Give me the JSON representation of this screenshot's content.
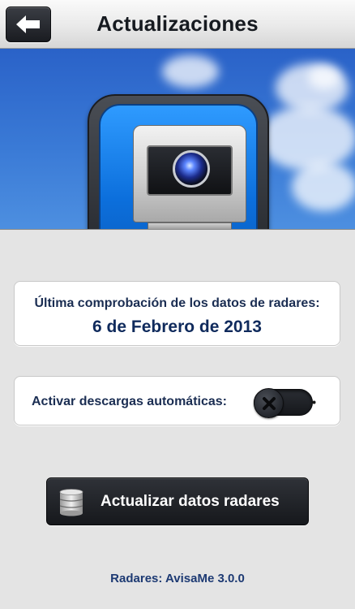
{
  "navbar": {
    "title": "Actualizaciones",
    "back_icon": "arrow-left-icon"
  },
  "hero": {
    "icon": "speed-camera-app-icon"
  },
  "last_check": {
    "label": "Última comprobación de los datos de radares:",
    "date": "6 de Febrero de 2013"
  },
  "auto_download": {
    "label": "Activar descargas automáticas:",
    "enabled": false,
    "toggle_icon": "x-icon"
  },
  "update_button": {
    "label": "Actualizar datos radares",
    "icon": "database-icon"
  },
  "footer": {
    "version": "Radares: AvisaMe 3.0.0"
  },
  "colors": {
    "sky": "#3a7ad6",
    "text_dark_blue": "#1a2d52",
    "button_dark": "#1f2227"
  }
}
